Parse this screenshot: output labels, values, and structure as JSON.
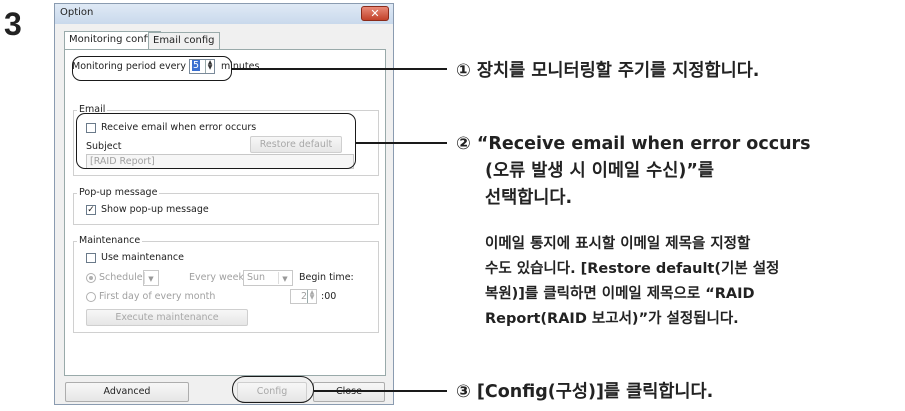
{
  "step_number": "3",
  "dialog": {
    "title": "Option",
    "close_glyph": "✕",
    "tabs": [
      "Monitoring config",
      "Email config"
    ],
    "monitoring": {
      "period_label": "Monitoring period every",
      "period_value": "5",
      "period_unit": "minutes"
    },
    "email": {
      "group_title": "Email",
      "receive_checkbox_label": "Receive email when error occurs",
      "receive_checked": false,
      "subject_label": "Subject",
      "restore_default_button": "Restore default",
      "subject_value": "[RAID Report]"
    },
    "popup": {
      "group_title": "Pop-up message",
      "show_checkbox_label": "Show pop-up message",
      "show_checked": true
    },
    "maintenance": {
      "group_title": "Maintenance",
      "use_checkbox_label": "Use maintenance",
      "schedule_label": "Schedule",
      "every_week_label": "Every week",
      "day_value": "Sun",
      "begin_time_label": "Begin time:",
      "first_day_label": "First day of every month",
      "hour_value": "2",
      "minute_suffix": ":00",
      "execute_button": "Execute maintenance"
    },
    "footer": {
      "advanced_button": "Advanced",
      "config_button": "Config",
      "close_button": "Close"
    }
  },
  "annotations": {
    "a1": {
      "marker": "①",
      "text": "장치를 모니터링할 주기를 지정합니다."
    },
    "a2": {
      "marker": "②",
      "line1": "“Receive email when error occurs",
      "line2": "(오류 발생 시 이메일 수신)”를",
      "line3": "선택합니다.",
      "note1": "이메일 통지에 표시할 이메일 제목을 지정할",
      "note2": "수도 있습니다. [Restore default(기본 설정",
      "note3": "복원)]를 클릭하면 이메일 제목으로 “RAID",
      "note4": "Report(RAID 보고서)”가 설정됩니다."
    },
    "a3": {
      "marker": "③",
      "text": "[Config(구성)]를 클릭합니다."
    }
  }
}
